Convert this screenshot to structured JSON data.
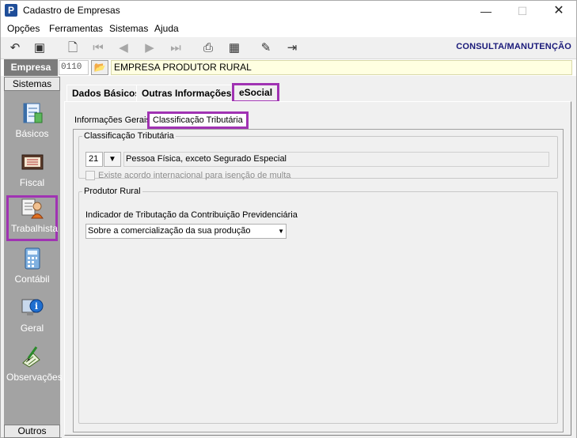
{
  "window": {
    "title": "Cadastro de Empresas",
    "app_icon": "P",
    "min_glyph": "—",
    "max_glyph": "☐",
    "close_glyph": "✕"
  },
  "menu": [
    "Opções",
    "Ferramentas",
    "Sistemas",
    "Ajuda"
  ],
  "toolbar": {
    "mode_label": "CONSULTA/MANUTENÇÃO",
    "buttons": [
      {
        "icon": "undo-icon",
        "glyph": "↶"
      },
      {
        "icon": "save-icon",
        "glyph": "▣"
      },
      {
        "icon": "preview-icon",
        "glyph": "🗋"
      },
      {
        "icon": "first-record-icon",
        "glyph": "⏮"
      },
      {
        "icon": "previous-record-icon",
        "glyph": "◀"
      },
      {
        "icon": "next-record-icon",
        "glyph": "▶"
      },
      {
        "icon": "last-record-icon",
        "glyph": "⏭"
      },
      {
        "icon": "print-icon",
        "glyph": "⎙"
      },
      {
        "icon": "calculator-icon",
        "glyph": "▦"
      },
      {
        "icon": "stamp-icon",
        "glyph": "✎"
      },
      {
        "icon": "exit-door-icon",
        "glyph": "⇥"
      }
    ]
  },
  "empresa": {
    "label": "Empresa",
    "code": "0110",
    "name": "EMPRESA PRODUTOR RURAL",
    "folder_glyph": "📂"
  },
  "sidebar": {
    "header": "Sistemas",
    "footer": "Outros",
    "items": [
      {
        "label": "Básicos",
        "icon": "notebook-icon"
      },
      {
        "label": "Fiscal",
        "icon": "fiscal-book-icon"
      },
      {
        "label": "Trabalhista",
        "icon": "worker-icon"
      },
      {
        "label": "Contábil",
        "icon": "calculator-icon"
      },
      {
        "label": "Geral",
        "icon": "info-monitor-icon"
      },
      {
        "label": "Observações",
        "icon": "pen-notes-icon"
      }
    ]
  },
  "tabs": [
    "Dados Básicos",
    "Outras Informações",
    "eSocial"
  ],
  "inner_tabs": [
    "Informações Gerais",
    "Classificação Tributária"
  ],
  "classificacao": {
    "legend": "Classificação Tributária",
    "code": "21",
    "description": "Pessoa Física, exceto Segurado Especial",
    "checkbox_label": "Existe acordo internacional para isenção de multa",
    "checkbox_checked": false
  },
  "produtor_rural": {
    "legend": "Produtor Rural",
    "field_label": "Indicador de Tributação da Contribuição Previdenciária",
    "selected_value": "Sobre a comercialização da sua produção"
  },
  "colors": {
    "highlight": "#a033b3",
    "sidebar_bg": "#a3a3a3",
    "mode_label": "#1a1a7a"
  }
}
